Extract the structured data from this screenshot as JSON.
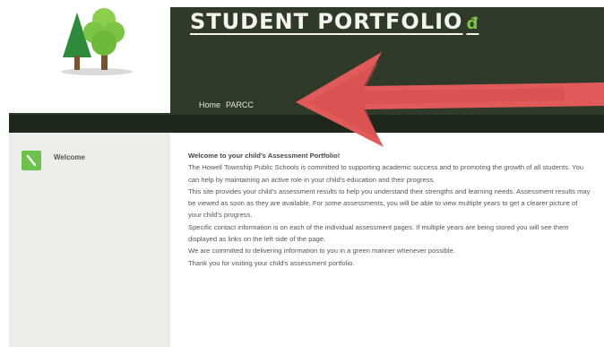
{
  "header": {
    "title": "STUDENT PORTFOLIO",
    "title_icon": "apple-icon",
    "logo_icon": "tree-logo-icon"
  },
  "nav": {
    "items": [
      {
        "label": "Home"
      },
      {
        "label": "PARCC"
      }
    ]
  },
  "sidebar": {
    "items": [
      {
        "label": "Welcome",
        "icon": "pencil-icon"
      }
    ]
  },
  "main": {
    "paragraphs": [
      "Welcome to your child's Assessment Portfolio!",
      "The Howell Township Public Schools is committed to supporting academic success and to promoting the growth of all students. You can help by maintaining an active role in your child's education and their progress.",
      "This site provides your child's assessment results to help you understand their strengths and learning needs. Assessment results may be viewed as soon as they are available. For some assessments, you will be able to view multiple years to get a clearer picture of your child's progress.",
      "Specific contact information is on each of the individual assessment pages. If multiple years are being stored you will see them displayed as links on the left side of the page.",
      "We are committed to delivering information to you in a green manner whenever possible.",
      "Thank you for visiting your child's assessment portfolio."
    ]
  },
  "colors": {
    "header_bg": "#2f3a2a",
    "accent_green": "#6cc24a",
    "arrow_red": "#e05a5a"
  }
}
